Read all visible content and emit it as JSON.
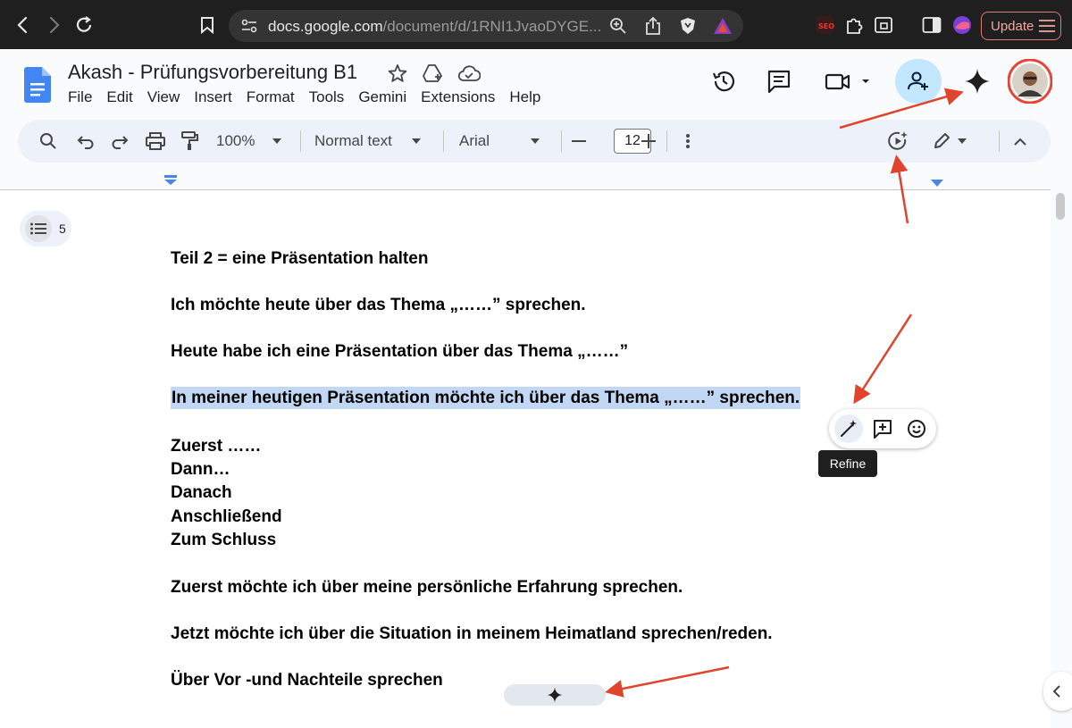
{
  "browser": {
    "url_host": "docs.google.com",
    "url_path": "/document/d/1RNI1JvaoDYGE...",
    "update_label": "Update"
  },
  "doc": {
    "title": "Akash - Prüfungsvorbereitung B1",
    "menu": [
      "File",
      "Edit",
      "View",
      "Insert",
      "Format",
      "Tools",
      "Gemini",
      "Extensions",
      "Help"
    ]
  },
  "toolbar": {
    "zoom": "100%",
    "style": "Normal text",
    "font": "Arial",
    "font_size": "12"
  },
  "outline": {
    "count": "5"
  },
  "content": {
    "lines": [
      "Teil 2 = eine Präsentation halten",
      "Ich möchte heute über das Thema „……” sprechen.",
      "Heute habe ich eine Präsentation über das Thema „……”",
      "In meiner heutigen Präsentation möchte ich über das Thema „……” sprechen.",
      "Zuerst ……",
      "Dann…",
      "Danach",
      "Anschließend",
      "Zum Schluss",
      "Zuerst möchte ich über meine persönliche Erfahrung sprechen.",
      "Jetzt möchte ich über die Situation in meinem Heimatland sprechen/reden.",
      "Über Vor -und Nachteile sprechen"
    ]
  },
  "popup": {
    "tooltip": "Refine"
  },
  "colors": {
    "selection": "#c2d7f4",
    "annotation_arrow": "#e0442c",
    "accent": "#0b57d0"
  },
  "icons": [
    "back-icon",
    "forward-icon",
    "reload-icon",
    "bookmark-icon",
    "site-settings-icon",
    "zoom-icon",
    "share-icon",
    "brave-shield-icon",
    "brave-rewards-icon",
    "seo-extension-icon",
    "extensions-icon",
    "reading-list-icon",
    "sidebar-icon",
    "profile-icon",
    "docs-logo-icon",
    "star-icon",
    "move-to-drive-icon",
    "cloud-saved-icon",
    "history-icon",
    "comments-icon",
    "meet-icon",
    "share-person-icon",
    "gemini-icon",
    "avatar"
  ]
}
